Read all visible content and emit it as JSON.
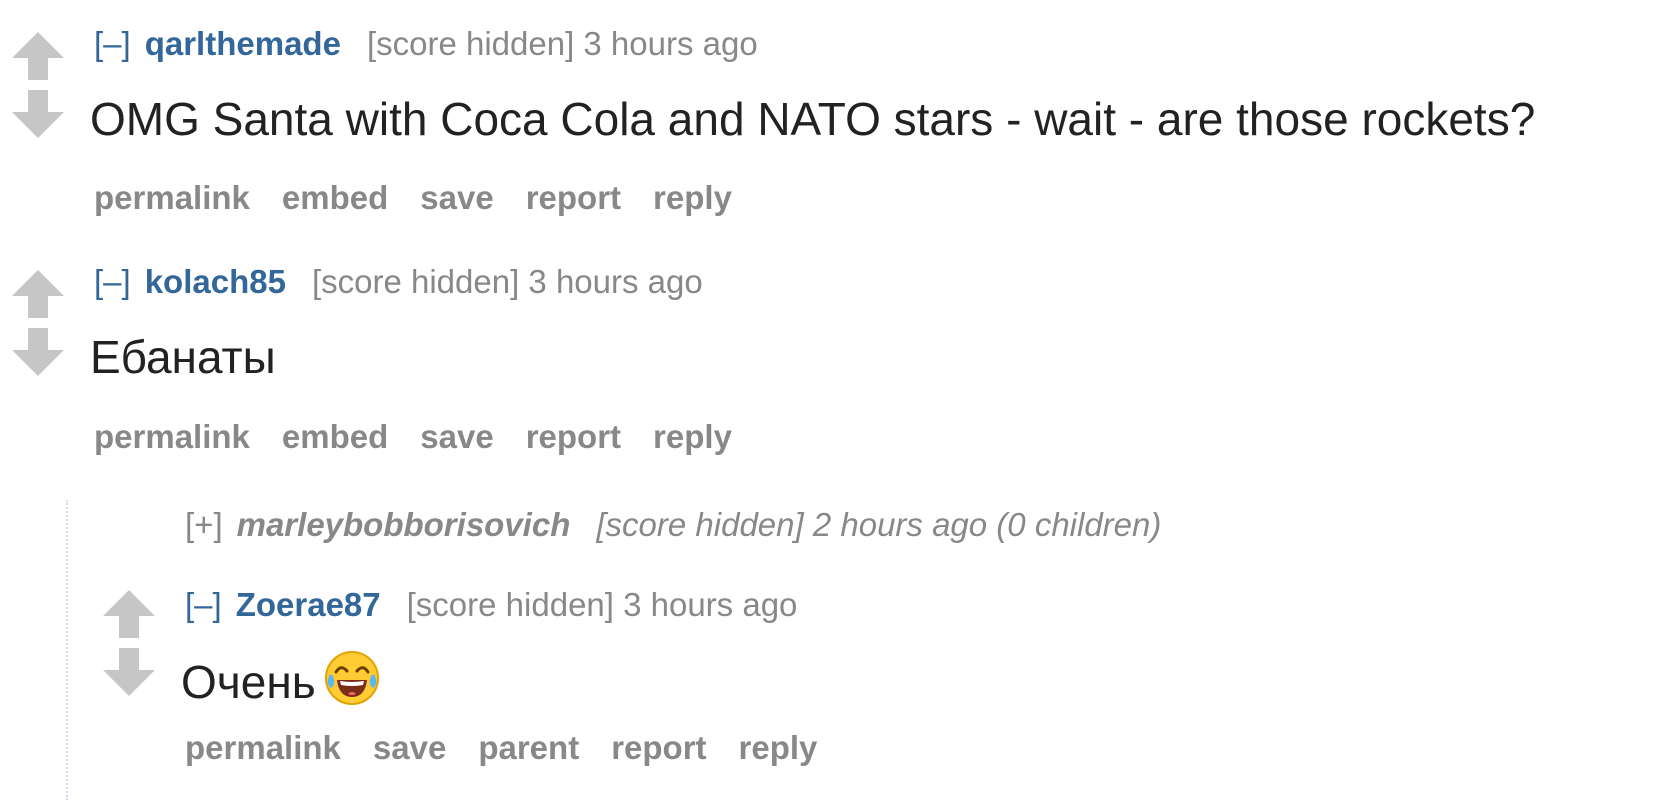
{
  "comments": [
    {
      "toggle": "[–]",
      "author": "qarlthemade",
      "meta": "[score hidden] 3 hours ago",
      "body": "OMG Santa with Coca Cola and NATO stars - wait - are those rockets?",
      "buttons": [
        "permalink",
        "embed",
        "save",
        "report",
        "reply"
      ]
    },
    {
      "toggle": "[–]",
      "author": "kolach85",
      "meta": "[score hidden] 3 hours ago",
      "body": "Ебанаты",
      "buttons": [
        "permalink",
        "embed",
        "save",
        "report",
        "reply"
      ]
    }
  ],
  "collapsed_child": {
    "toggle": "[+]",
    "author": "marleybobborisovich",
    "meta": "[score hidden] 2 hours ago (0 children)"
  },
  "child": {
    "toggle": "[–]",
    "author": "Zoerae87",
    "meta": "[score hidden] 3 hours ago",
    "body": "Очень",
    "emoji": "face-with-tears-of-joy-icon",
    "buttons": [
      "permalink",
      "save",
      "parent",
      "report",
      "reply"
    ]
  },
  "colors": {
    "link": "#336699",
    "meta": "#888888",
    "text": "#222222",
    "arrow": "#c6c6c6"
  }
}
